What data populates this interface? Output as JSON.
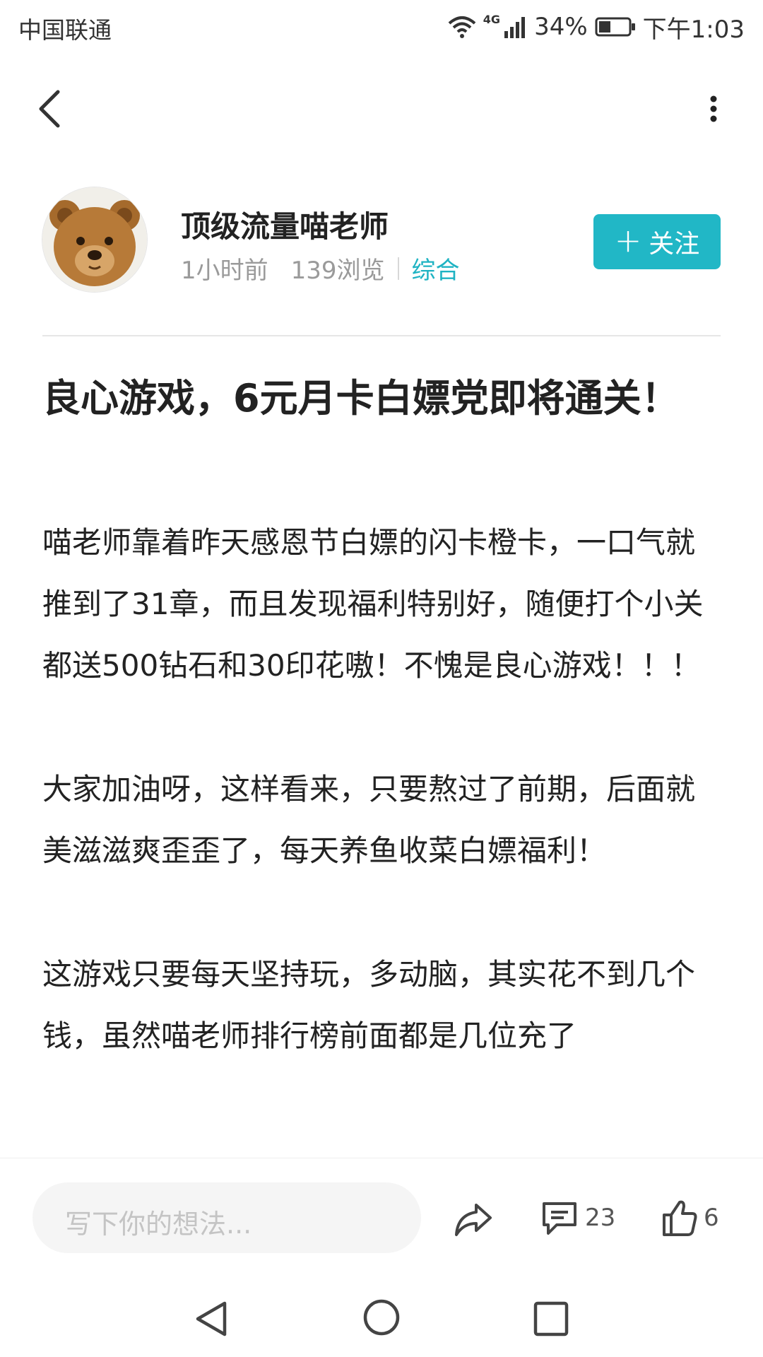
{
  "status_bar": {
    "carrier": "中国联通",
    "network": "4G",
    "battery": "34%",
    "time": "下午1:03"
  },
  "author": {
    "name": "顶级流量喵老师",
    "time_ago": "1小时前",
    "views": "139浏览",
    "category": "综合",
    "follow_label": "关注",
    "follow_plus": "+"
  },
  "article": {
    "title": "良心游戏，6元月卡白嫖党即将通关！",
    "paragraphs": [
      "喵老师靠着昨天感恩节白嫖的闪卡橙卡，一口气就推到了31章，而且发现福利特别好，随便打个小关都送500钻石和30印花嗷！不愧是良心游戏！！！",
      "大家加油呀，这样看来，只要熬过了前期，后面就美滋滋爽歪歪了，每天养鱼收菜白嫖福利！",
      "这游戏只要每天坚持玩，多动脑，其实花不到几个钱，虽然喵老师排行榜前面都是几位充了"
    ]
  },
  "bottom_bar": {
    "comment_placeholder": "写下你的想法...",
    "comment_count": "23",
    "like_count": "6"
  },
  "colors": {
    "accent": "#21b7c6",
    "category": "#1fb3c3"
  },
  "icons": [
    "back-icon",
    "more-icon",
    "share-icon",
    "comment-icon",
    "like-icon",
    "wifi-icon",
    "signal-icon",
    "battery-icon"
  ]
}
